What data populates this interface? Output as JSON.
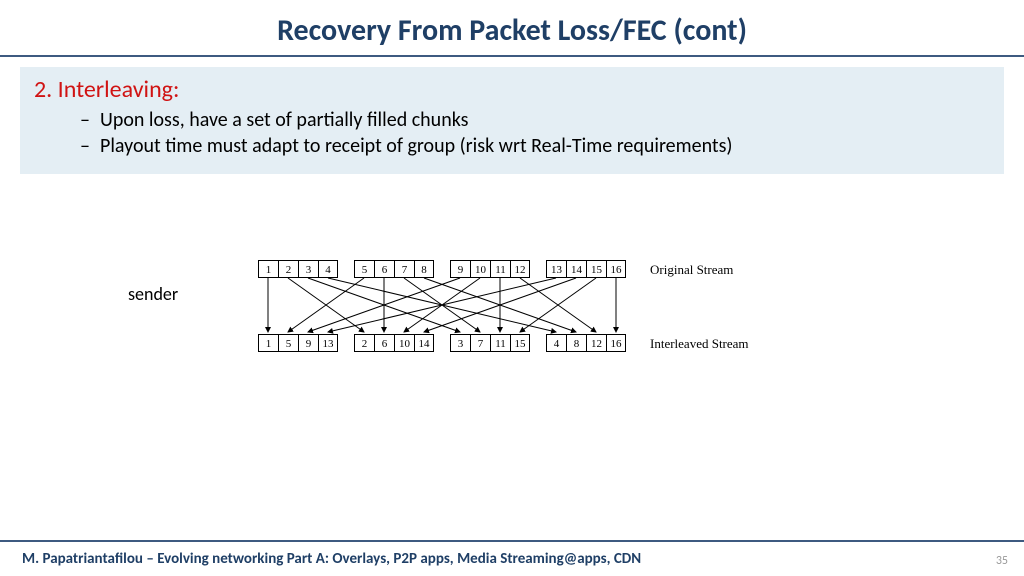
{
  "title": "Recovery From Packet Loss/FEC (cont)",
  "section": {
    "heading": "2. Interleaving:"
  },
  "bullets": [
    "Upon loss, have a set of partially filled chunks",
    "Playout time must adapt to receipt of group (risk wrt Real-Time requirements)"
  ],
  "sender_label": "sender",
  "stream": {
    "original_label": "Original Stream",
    "interleaved_label": "Interleaved Stream",
    "original_groups": [
      [
        "1",
        "2",
        "3",
        "4"
      ],
      [
        "5",
        "6",
        "7",
        "8"
      ],
      [
        "9",
        "10",
        "11",
        "12"
      ],
      [
        "13",
        "14",
        "15",
        "16"
      ]
    ],
    "interleaved_groups": [
      [
        "1",
        "5",
        "9",
        "13"
      ],
      [
        "2",
        "6",
        "10",
        "14"
      ],
      [
        "3",
        "7",
        "11",
        "15"
      ],
      [
        "4",
        "8",
        "12",
        "16"
      ]
    ]
  },
  "footer": "M. Papatriantafilou –  Evolving networking Part A: Overlays, P2P apps, Media Streaming@apps, CDN",
  "page": "35"
}
